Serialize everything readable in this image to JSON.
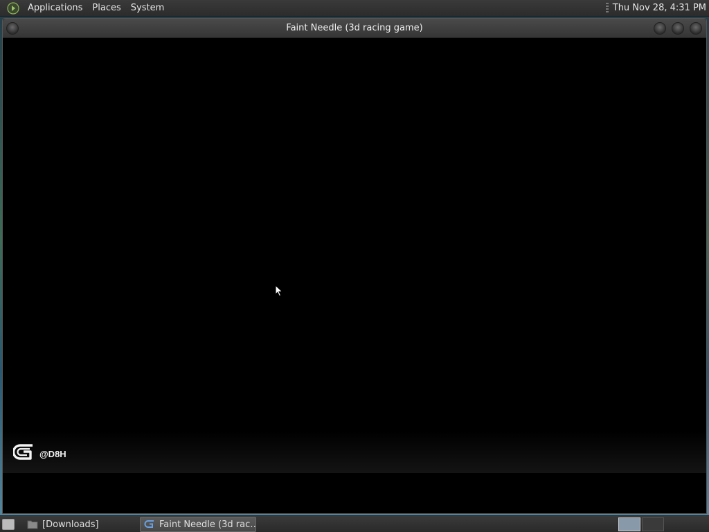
{
  "top_panel": {
    "menus": [
      "Applications",
      "Places",
      "System"
    ],
    "clock": "Thu Nov 28,  4:31 PM"
  },
  "window": {
    "title": "Faint Needle (3d racing game)",
    "logo_text": "@D8H"
  },
  "taskbar": {
    "items": [
      {
        "label": "[Downloads]",
        "icon": "folder-icon"
      },
      {
        "label": "Faint Needle (3d rac…",
        "icon": "gdevelop-icon",
        "active": true
      }
    ]
  },
  "icons": {
    "menu_logo": "linux-mint-logo",
    "game_logo": "gdevelop-logo",
    "cursor": "mouse-pointer"
  }
}
